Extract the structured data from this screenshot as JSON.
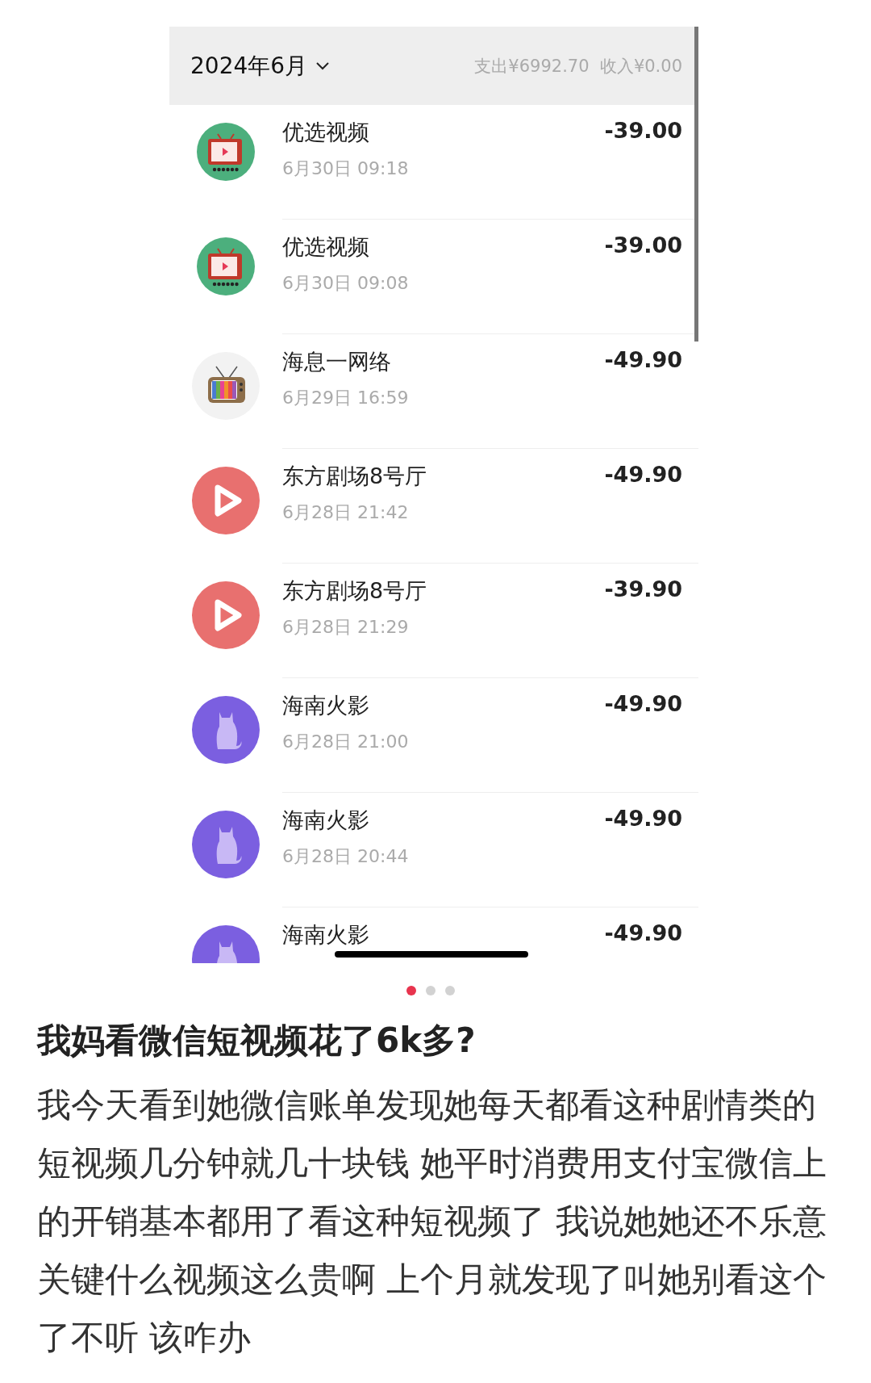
{
  "bill": {
    "month": "2024年6月",
    "summary": "支出¥6992.70  收入¥0.00",
    "rows": [
      {
        "kind": "tv",
        "name": "优选视频",
        "time": "6月30日 09:18",
        "amount": "-39.00"
      },
      {
        "kind": "tv",
        "name": "优选视频",
        "time": "6月30日 09:08",
        "amount": "-39.00"
      },
      {
        "kind": "retro",
        "name": "海息一网络",
        "time": "6月29日 16:59",
        "amount": "-49.90"
      },
      {
        "kind": "play",
        "name": "东方剧场8号厅",
        "time": "6月28日 21:42",
        "amount": "-49.90"
      },
      {
        "kind": "play",
        "name": "东方剧场8号厅",
        "time": "6月28日 21:29",
        "amount": "-39.90"
      },
      {
        "kind": "cat",
        "name": "海南火影",
        "time": "6月28日 21:00",
        "amount": "-49.90"
      },
      {
        "kind": "cat",
        "name": "海南火影",
        "time": "6月28日 20:44",
        "amount": "-49.90"
      },
      {
        "kind": "cat",
        "name": "海南火影",
        "amount": "-49.90"
      }
    ]
  },
  "pager": [
    {
      "selected": true
    },
    {
      "selected": false
    },
    {
      "selected": false
    }
  ],
  "post": {
    "title": "我妈看微信短视频花了6k多?",
    "body": "我今天看到她微信账单发现她每天都看这种剧情类的短视频几分钟就几十块钱 她平时消费用支付宝微信上的开销基本都用了看这种短视频了 我说她她还不乐意关键什么视频这么贵啊 上个月就发现了叫她别看这个了不听 该咋办"
  }
}
